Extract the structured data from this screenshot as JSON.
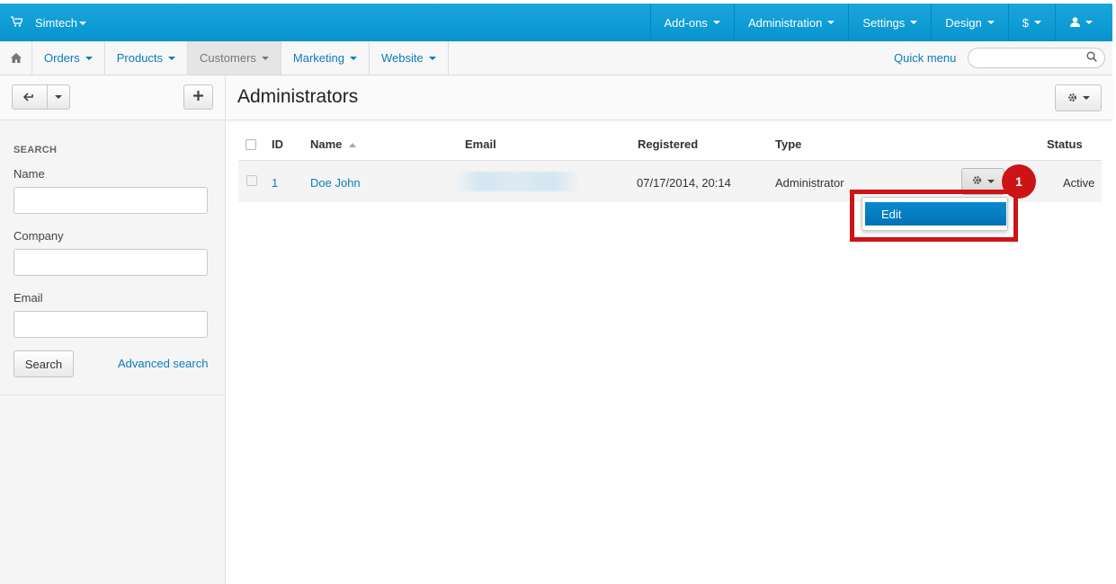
{
  "topbar": {
    "brand": "Simtech",
    "items": [
      "Add-ons",
      "Administration",
      "Settings",
      "Design",
      "$",
      ""
    ]
  },
  "subnav": {
    "items": [
      "Orders",
      "Products",
      "Customers",
      "Marketing",
      "Website"
    ],
    "active_index": 2,
    "quick_menu": "Quick menu",
    "search_placeholder": ""
  },
  "page": {
    "title": "Administrators"
  },
  "sidebar": {
    "section_title": "SEARCH",
    "name_label": "Name",
    "company_label": "Company",
    "email_label": "Email",
    "search_button": "Search",
    "advanced_search": "Advanced search"
  },
  "table": {
    "headers": {
      "id": "ID",
      "name": "Name",
      "email": "Email",
      "registered": "Registered",
      "type": "Type",
      "status": "Status"
    },
    "rows": [
      {
        "id": "1",
        "name": "Doe John",
        "email": "",
        "registered": "07/17/2014, 20:14",
        "type": "Administrator",
        "status": "Active"
      }
    ]
  },
  "dropdown": {
    "edit": "Edit"
  },
  "annotation": {
    "step": "1"
  },
  "colors": {
    "topbar": "#0d9fd8",
    "link": "#0b7dbb",
    "highlight": "#cc1417",
    "menu_active": "#0a84c8"
  },
  "icons": [
    "cart-icon",
    "home-icon",
    "search-icon",
    "back-icon",
    "plus-icon",
    "gear-icon",
    "user-icon",
    "sort-asc-icon"
  ]
}
